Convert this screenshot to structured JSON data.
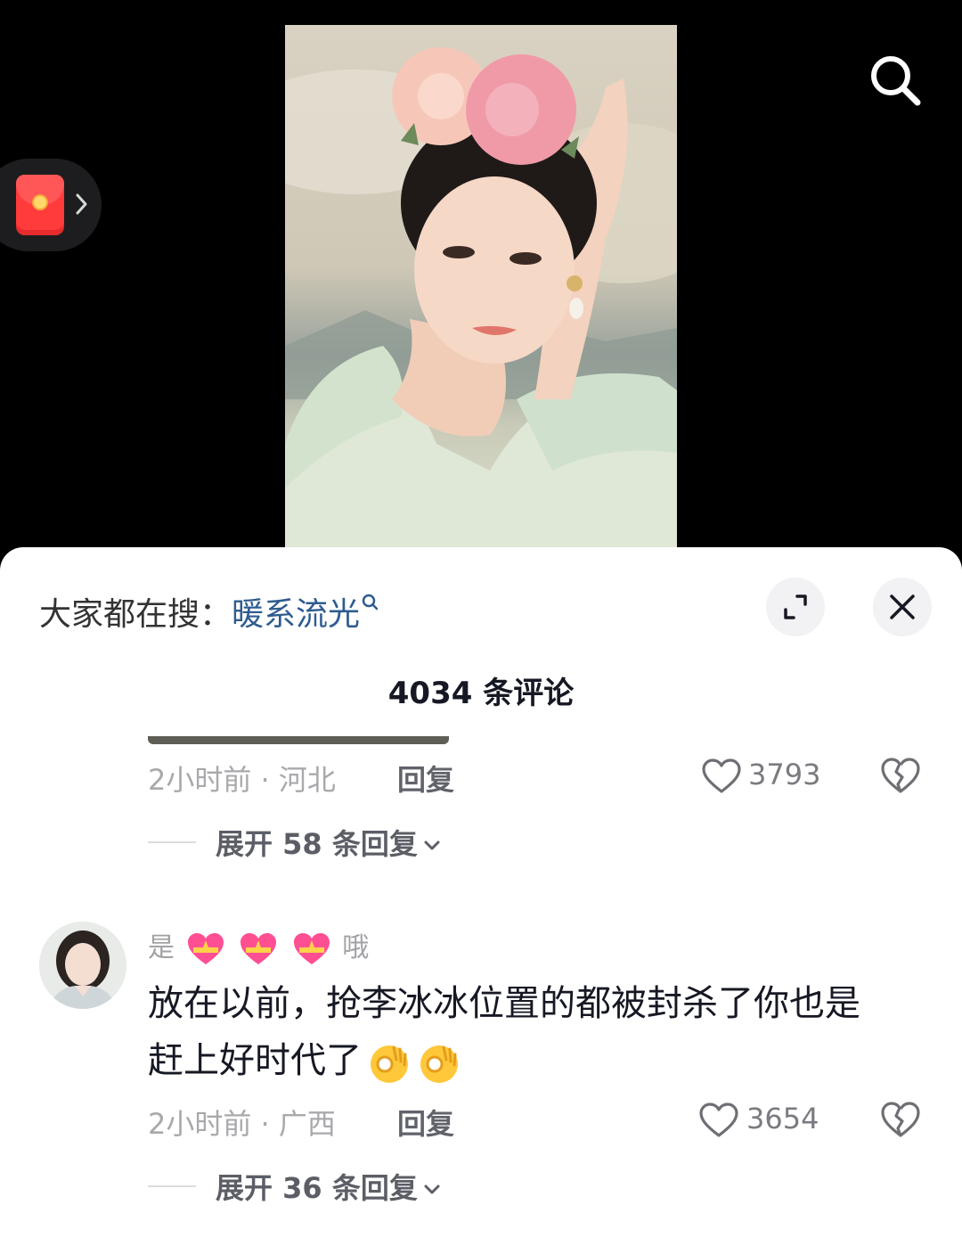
{
  "header": {
    "search_icon": "search-icon",
    "red_packet_icon": "red-packet-icon"
  },
  "sheet": {
    "hot_search_prefix": "大家都在搜：",
    "hot_search_keyword": "暖系流光",
    "comment_count_title": "4034 条评论",
    "expand_icon": "expand-icon",
    "close_icon": "close-icon"
  },
  "comments": [
    {
      "meta": "2小时前 · 河北",
      "reply_label": "回复",
      "likes": "3793",
      "expand_replies": "展开 58 条回复"
    },
    {
      "username_start": "是",
      "username_end": "哦",
      "text_line1": "放在以前，抢李冰冰位置的都被封杀了你也是",
      "text_line2": "赶上好时代了",
      "meta": "2小时前 · 广西",
      "reply_label": "回复",
      "likes": "3654",
      "expand_replies": "展开 36 条回复"
    }
  ],
  "colors": {
    "keyword": "#2f5c8f",
    "sheet_bg": "#ffffff",
    "video_bg": "#000000"
  }
}
